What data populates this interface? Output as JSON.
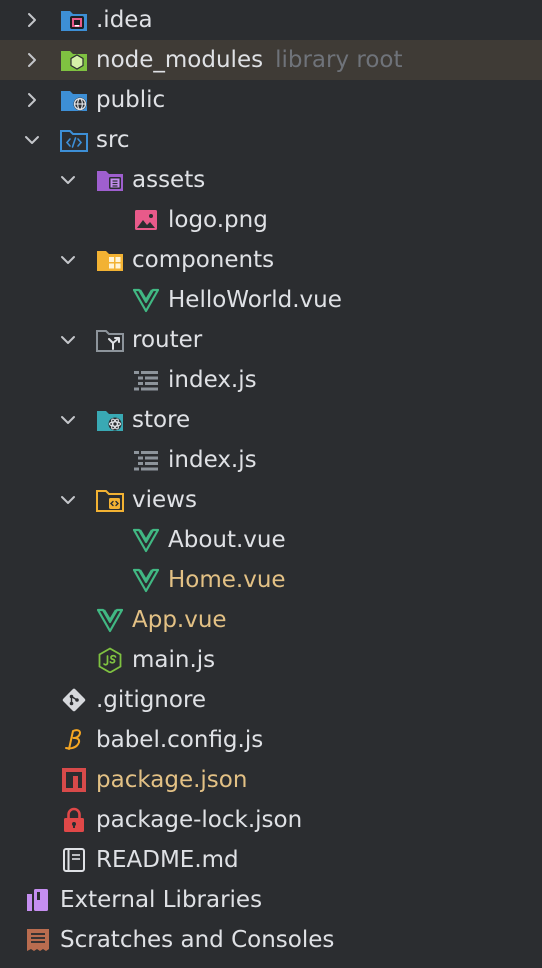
{
  "tree": {
    "idea": {
      "label": ".idea"
    },
    "node_modules": {
      "label": "node_modules",
      "hint": "library root"
    },
    "public": {
      "label": "public"
    },
    "src": {
      "label": "src"
    },
    "assets": {
      "label": "assets"
    },
    "logo": {
      "label": "logo.png"
    },
    "components": {
      "label": "components"
    },
    "helloworld": {
      "label": "HelloWorld.vue"
    },
    "router": {
      "label": "router"
    },
    "router_index": {
      "label": "index.js"
    },
    "store": {
      "label": "store"
    },
    "store_index": {
      "label": "index.js"
    },
    "views": {
      "label": "views"
    },
    "about": {
      "label": "About.vue"
    },
    "home": {
      "label": "Home.vue"
    },
    "app": {
      "label": "App.vue"
    },
    "main": {
      "label": "main.js"
    },
    "gitignore": {
      "label": ".gitignore"
    },
    "babel": {
      "label": "babel.config.js"
    },
    "package": {
      "label": "package.json"
    },
    "package_lock": {
      "label": "package-lock.json"
    },
    "readme": {
      "label": "README.md"
    },
    "external_libraries": {
      "label": "External Libraries"
    },
    "scratches": {
      "label": "Scratches and Consoles"
    }
  },
  "colors": {
    "background": "#2b2d30",
    "highlight_row": "#3f3b36",
    "text": "#dfe1e5",
    "modified_text": "#e3c185",
    "hint_text": "#6f737a",
    "folder_blue": "#3d8fd6",
    "folder_green": "#7fc241",
    "folder_purple": "#9f5fcf",
    "folder_orange": "#f2b233",
    "folder_gray": "#8d949b",
    "folder_teal": "#39a9b4",
    "vue_green": "#41b883",
    "image_pink": "#e85a8a",
    "npm_red": "#d84a4a",
    "lock_red": "#e04848",
    "babel_orange": "#f5a623"
  },
  "icons": {
    "idea": "intellij-folder-icon",
    "node_modules": "node-folder-icon",
    "public": "web-folder-icon",
    "src": "source-folder-icon",
    "assets": "resources-folder-icon",
    "logo": "image-file-icon",
    "components": "components-folder-icon",
    "vue": "vue-file-icon",
    "router": "router-folder-icon",
    "js_index": "js-module-icon",
    "store": "store-folder-icon",
    "views": "views-folder-icon",
    "main": "nodejs-file-icon",
    "gitignore": "git-icon",
    "babel": "babel-icon",
    "package": "npm-icon",
    "package_lock": "lock-icon",
    "readme": "markdown-book-icon",
    "external_libraries": "library-icon",
    "scratches": "scratches-icon"
  }
}
